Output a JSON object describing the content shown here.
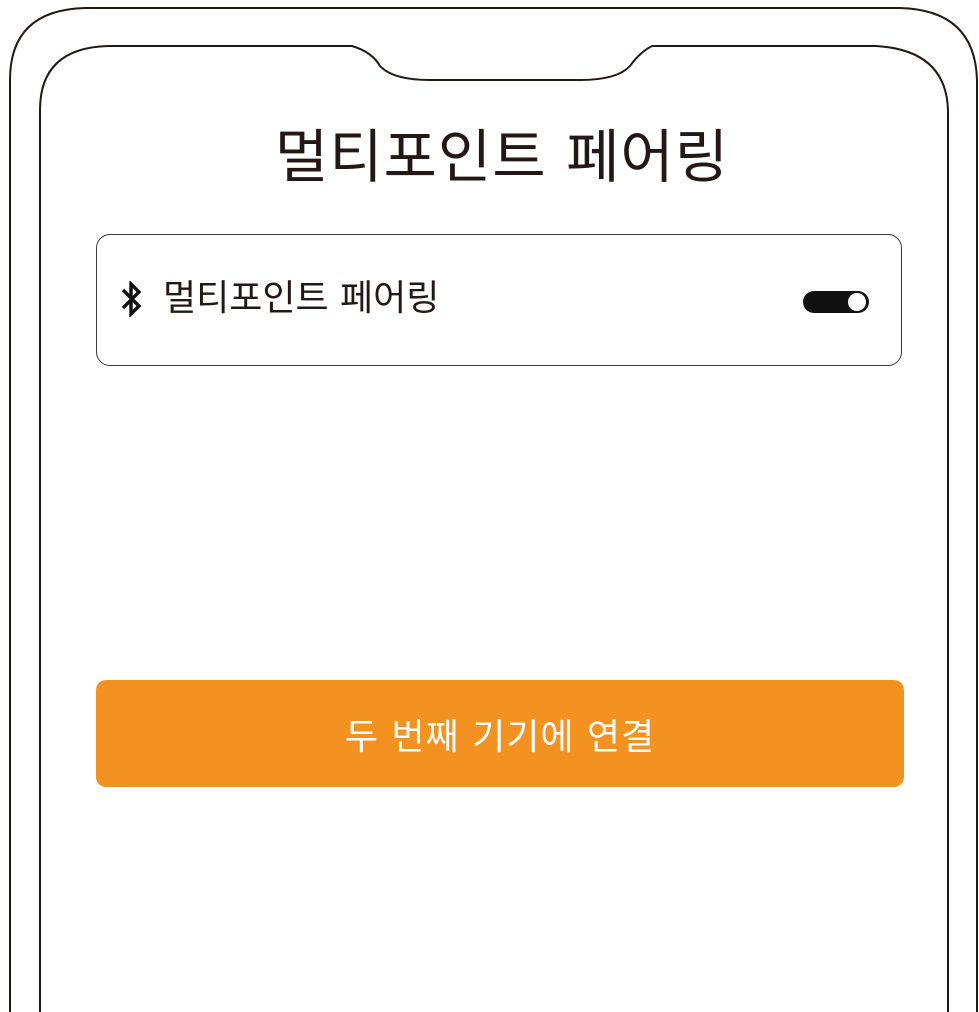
{
  "page": {
    "title": "멀티포인트 페어링"
  },
  "settings": {
    "multipoint": {
      "icon": "bluetooth-icon",
      "label": "멀티포인트 페어링",
      "enabled": true
    }
  },
  "actions": {
    "connect_label": "두 번째 기기에 연결"
  },
  "colors": {
    "accent": "#f39221",
    "text": "#231815",
    "toggle_on": "#111111"
  }
}
